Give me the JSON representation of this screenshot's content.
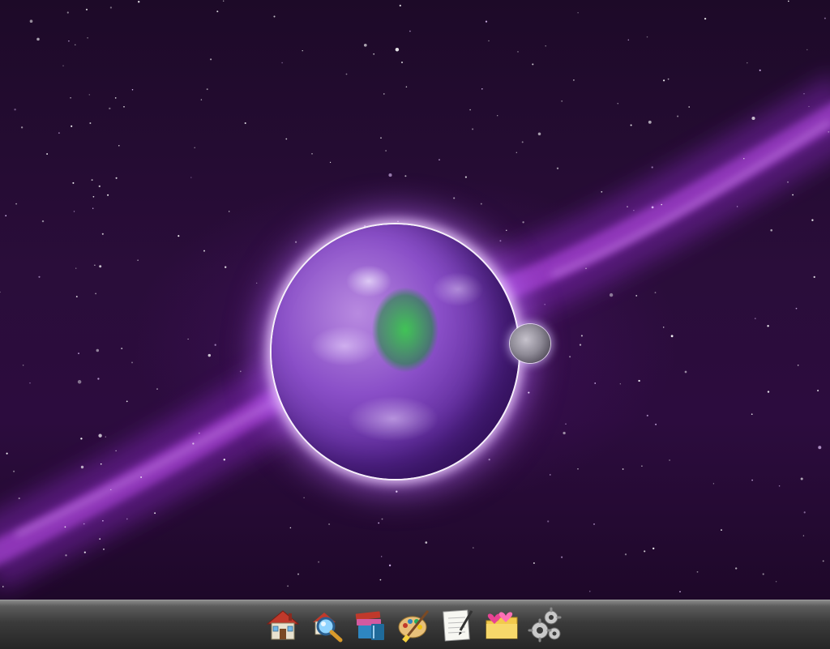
{
  "desktop": {
    "wallpaper_icon": "purple-earth-space-wallpaper",
    "colors": {
      "space": "#1d0a28",
      "nebula": "#9b30d6",
      "planet_glow": "#c890ff"
    }
  },
  "taskbar": {
    "apps": [
      {
        "icon": "home-icon",
        "label": ""
      },
      {
        "icon": "search-magnifier-icon",
        "label": ""
      },
      {
        "icon": "books-icon",
        "label": ""
      },
      {
        "icon": "paint-palette-icon",
        "label": ""
      },
      {
        "icon": "notepad-pen-icon",
        "label": ""
      },
      {
        "icon": "favorites-folder-icon",
        "label": ""
      },
      {
        "icon": "settings-gears-icon",
        "label": ""
      }
    ]
  }
}
